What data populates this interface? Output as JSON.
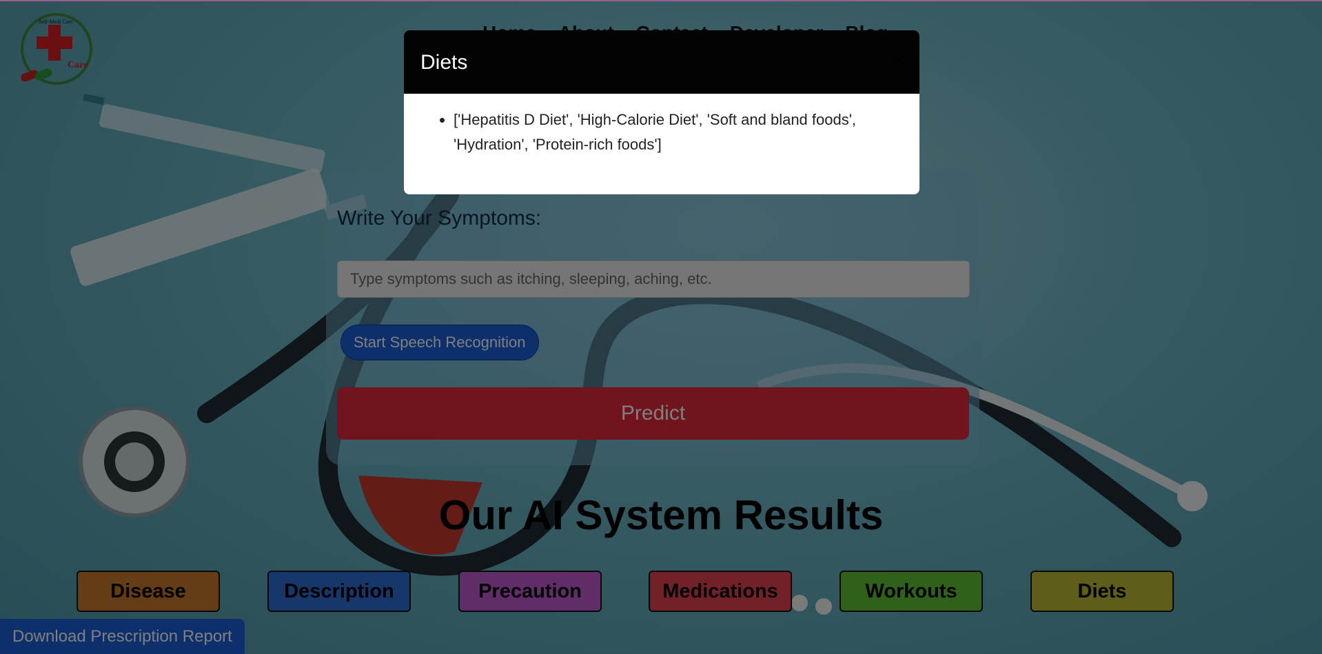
{
  "nav": {
    "items": [
      "Home",
      "About",
      "Contact",
      "Developer",
      "Blog"
    ]
  },
  "logo": {
    "text_top": "Self-Medi Care",
    "text_brand": "Care"
  },
  "form": {
    "label": "Write Your Symptoms:",
    "input_placeholder": "Type symptoms such as itching, sleeping, aching, etc.",
    "input_value": "",
    "speech_button": "Start Speech Recognition",
    "predict_button": "Predict"
  },
  "results": {
    "title": "Our AI System Results",
    "buttons": [
      {
        "label": "Disease",
        "color": "#c8792a"
      },
      {
        "label": "Description",
        "color": "#2f6fd4"
      },
      {
        "label": "Precaution",
        "color": "#c25ad0"
      },
      {
        "label": "Medications",
        "color": "#e2424f"
      },
      {
        "label": "Workouts",
        "color": "#5fc234"
      },
      {
        "label": "Diets",
        "color": "#bdbb32"
      }
    ]
  },
  "download_button": "Download Prescription Report",
  "modal": {
    "title": "Diets",
    "close_glyph": "×",
    "items": [
      "['Hepatitis D Diet', 'High-Calorie Diet', 'Soft and bland foods', 'Hydration', 'Protein-rich foods']"
    ]
  },
  "colors": {
    "predict": "#e4283c",
    "speech": "#1a5fd6",
    "download": "#1a5fd6",
    "modal_header": "#030303"
  }
}
